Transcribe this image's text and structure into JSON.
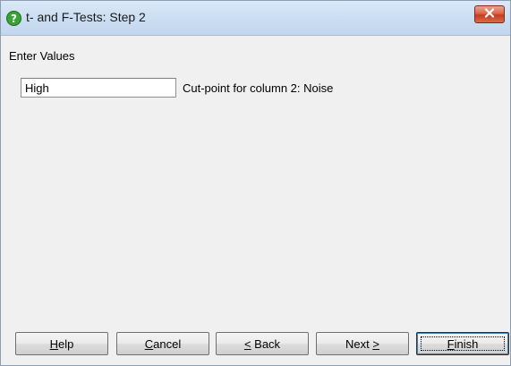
{
  "window": {
    "title": "t- and F-Tests: Step 2",
    "title_icon": "question-icon",
    "close_icon": "close-icon",
    "colors": {
      "title_icon": "#3aa335",
      "close_button": "#c9482a"
    }
  },
  "form": {
    "section_label": "Enter Values",
    "value_input": {
      "value": "High",
      "label": "Cut-point for column 2: Noise"
    }
  },
  "buttons": {
    "help": {
      "mnemonic": "H",
      "rest": "elp"
    },
    "cancel": {
      "mnemonic": "C",
      "rest": "ancel"
    },
    "back": {
      "mnemonic": "<",
      "rest": " Back"
    },
    "next": {
      "prefix": "Next ",
      "mnemonic": ">"
    },
    "finish": {
      "mnemonic": "F",
      "rest": "inish"
    }
  }
}
